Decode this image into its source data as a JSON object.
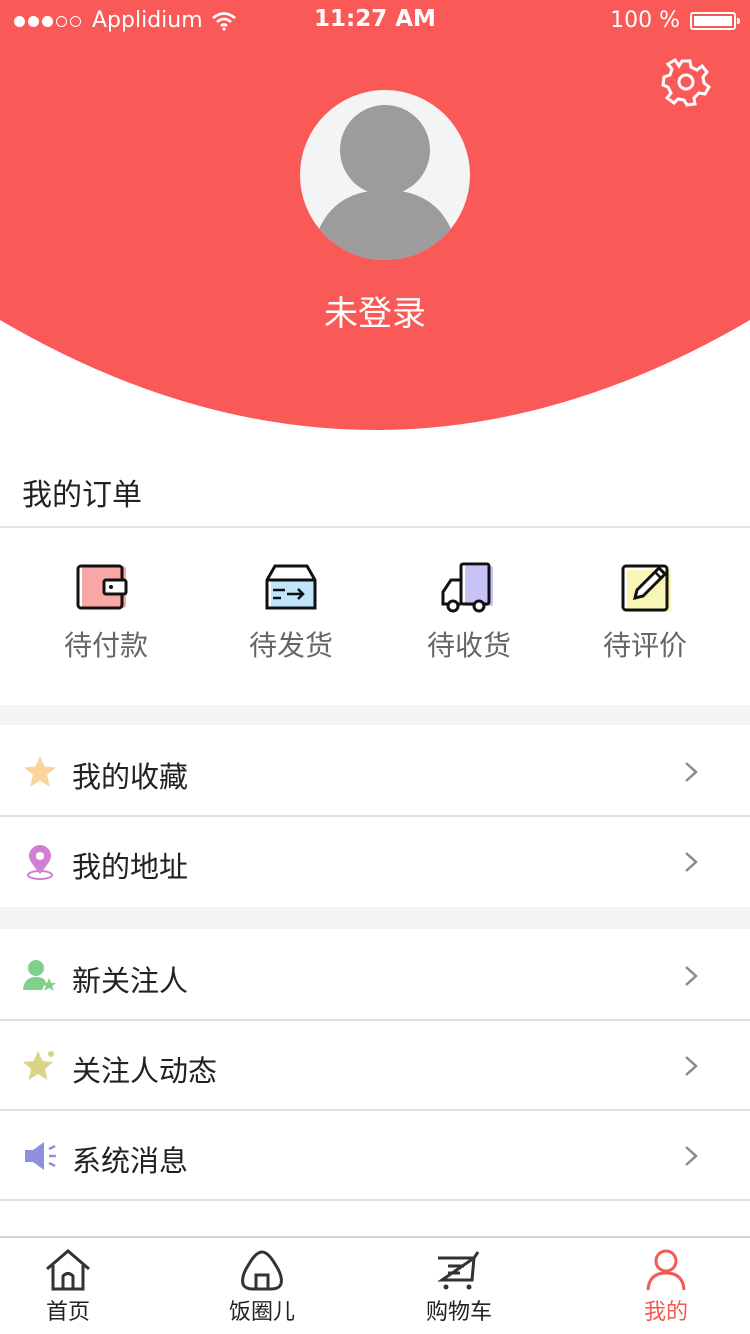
{
  "colors": {
    "brand": "#f95957",
    "active_tab": "#f25a56"
  },
  "status_bar": {
    "carrier": "Applidium",
    "time": "11:27 AM",
    "battery": "100 %"
  },
  "header": {
    "login_status": "未登录",
    "settings_icon": "gear-icon",
    "avatar_icon": "user-avatar-icon"
  },
  "orders": {
    "title": "我的订单",
    "items": [
      {
        "label": "待付款",
        "icon": "wallet-icon"
      },
      {
        "label": "待发货",
        "icon": "box-ship-icon"
      },
      {
        "label": "待收货",
        "icon": "truck-icon"
      },
      {
        "label": "待评价",
        "icon": "edit-review-icon"
      }
    ]
  },
  "menu_group_1": [
    {
      "label": "我的收藏",
      "icon": "star-icon"
    },
    {
      "label": "我的地址",
      "icon": "location-pin-icon"
    }
  ],
  "menu_group_2": [
    {
      "label": "新关注人",
      "icon": "new-follower-icon"
    },
    {
      "label": "关注人动态",
      "icon": "follow-activity-icon"
    },
    {
      "label": "系统消息",
      "icon": "megaphone-icon"
    }
  ],
  "tabbar": {
    "items": [
      {
        "label": "首页",
        "icon": "home-icon",
        "active": false
      },
      {
        "label": "饭圈儿",
        "icon": "rice-ball-icon",
        "active": false
      },
      {
        "label": "购物车",
        "icon": "cart-icon",
        "active": false
      },
      {
        "label": "我的",
        "icon": "profile-icon",
        "active": true
      }
    ]
  }
}
